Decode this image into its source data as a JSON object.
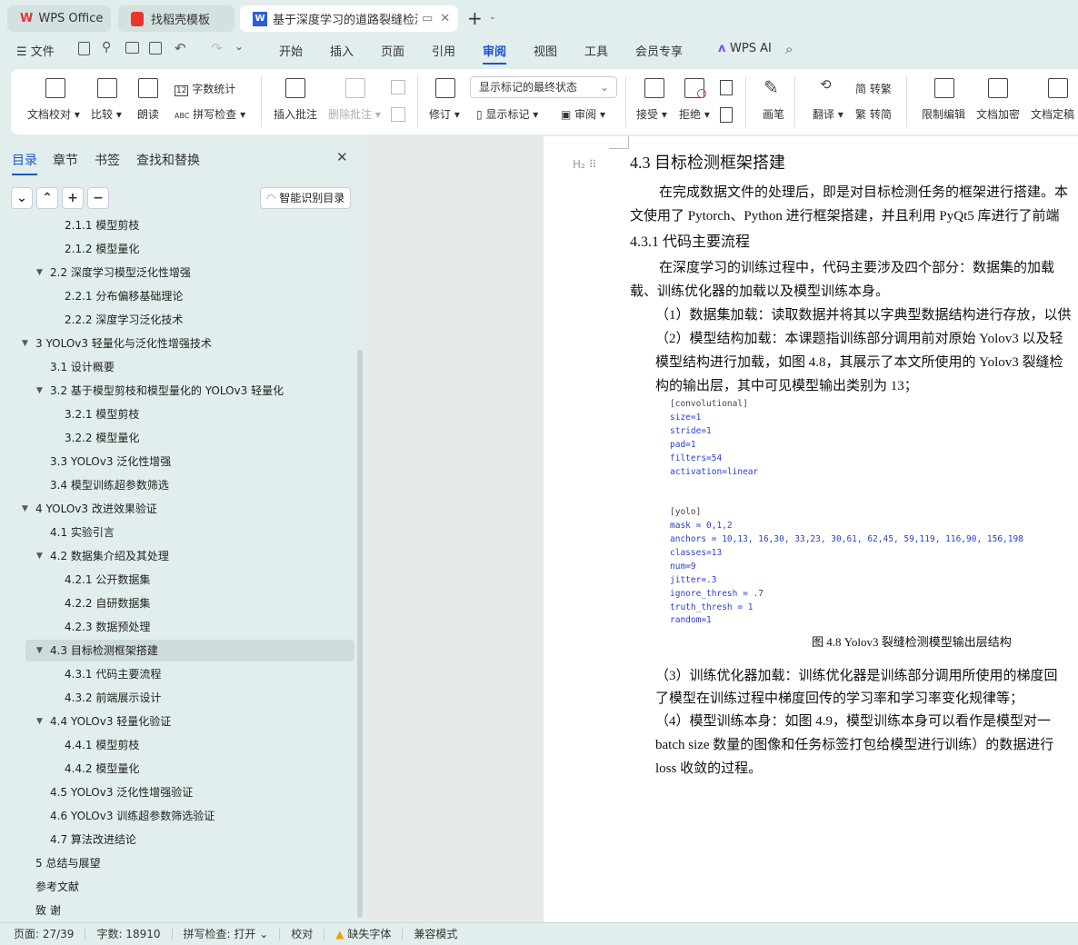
{
  "tabs": [
    {
      "label": "WPS Office",
      "icon": "wps-logo-icon"
    },
    {
      "label": "找稻壳模板",
      "icon": "docer-icon"
    },
    {
      "label": "基于深度学习的道路裂缝检测",
      "icon": "wps-writer-icon",
      "active": true
    }
  ],
  "menu": {
    "file": "文件",
    "items": [
      "开始",
      "插入",
      "页面",
      "引用",
      "审阅",
      "视图",
      "工具",
      "会员专享"
    ],
    "active": "审阅",
    "ai": "WPS AI"
  },
  "ribbon": {
    "proofread": "文档校对",
    "compare": "比较",
    "read_aloud": "朗读",
    "word_count": "字数统计",
    "spell_check": "拼写检查",
    "insert_comment": "插入批注",
    "delete_comment": "删除批注",
    "revise": "修订",
    "markup_state": "显示标记的最终状态",
    "show_markup": "显示标记",
    "review": "审阅",
    "accept": "接受",
    "reject": "拒绝",
    "pen": "画笔",
    "translate": "翻译",
    "to_traditional": "转繁",
    "to_simplified": "转简",
    "restrict_edit": "限制编辑",
    "encrypt": "文档加密",
    "finalize": "文档定稿"
  },
  "panel": {
    "tabs": [
      "目录",
      "章节",
      "书签",
      "查找和替换"
    ],
    "active": "目录",
    "smart_toc": "智能识别目录",
    "toc": [
      {
        "label": "2.1.1  模型剪枝",
        "level": 3
      },
      {
        "label": "2.1.2  模型量化",
        "level": 3
      },
      {
        "label": "2.2  深度学习模型泛化性增强",
        "level": 2,
        "expanded": true
      },
      {
        "label": "2.2.1  分布偏移基础理论",
        "level": 3
      },
      {
        "label": "2.2.2  深度学习泛化技术",
        "level": 3
      },
      {
        "label": "3  YOLOv3 轻量化与泛化性增强技术",
        "level": 1,
        "expanded": true
      },
      {
        "label": "3.1  设计概要",
        "level": 2
      },
      {
        "label": "3.2  基于模型剪枝和模型量化的 YOLOv3 轻量化",
        "level": 2,
        "expanded": true
      },
      {
        "label": "3.2.1  模型剪枝",
        "level": 3
      },
      {
        "label": "3.2.2  模型量化",
        "level": 3
      },
      {
        "label": "3.3  YOLOv3 泛化性增强",
        "level": 2
      },
      {
        "label": "3.4  模型训练超参数筛选",
        "level": 2
      },
      {
        "label": "4  YOLOv3 改进效果验证",
        "level": 1,
        "expanded": true
      },
      {
        "label": "4.1  实验引言",
        "level": 2
      },
      {
        "label": "4.2  数据集介绍及其处理",
        "level": 2,
        "expanded": true
      },
      {
        "label": "4.2.1  公开数据集",
        "level": 3
      },
      {
        "label": "4.2.2  自研数据集",
        "level": 3
      },
      {
        "label": "4.2.3  数据预处理",
        "level": 3
      },
      {
        "label": "4.3  目标检测框架搭建",
        "level": 2,
        "expanded": true,
        "selected": true
      },
      {
        "label": "4.3.1  代码主要流程",
        "level": 3
      },
      {
        "label": "4.3.2  前端展示设计",
        "level": 3
      },
      {
        "label": "4.4 YOLOv3 轻量化验证",
        "level": 2,
        "expanded": true
      },
      {
        "label": "4.4.1  模型剪枝",
        "level": 3
      },
      {
        "label": "4.4.2  模型量化",
        "level": 3
      },
      {
        "label": "4.5 YOLOv3 泛化性增强验证",
        "level": 2
      },
      {
        "label": "4.6 YOLOv3 训练超参数筛选验证",
        "level": 2
      },
      {
        "label": "4.7  算法改进结论",
        "level": 2
      },
      {
        "label": "5  总结与展望",
        "level": 1
      },
      {
        "label": "参考文献",
        "level": 1
      },
      {
        "label": "致  谢",
        "level": 1
      }
    ]
  },
  "doc": {
    "heading_marker": "H₂",
    "title": "4.3  目标检测框架搭建",
    "p1": [
      "在完成数据文件的处理后，即是对目标检测任务的框架进行搭建。本",
      "文使用了 Pytorch、Python 进行框架搭建，并且利用 PyQt5 库进行了前端"
    ],
    "h431": "4.3.1  代码主要流程",
    "p2": [
      "在深度学习的训练过程中，代码主要涉及四个部分：数据集的加载",
      "载、训练优化器的加载以及模型训练本身。"
    ],
    "p3": "（1）数据集加载：读取数据并将其以字典型数据结构进行存放，以供",
    "p4": [
      "（2）模型结构加载：本课题指训练部分调用前对原始 Yolov3 以及轻",
      "模型结构进行加载，如图 4.8，其展示了本文所使用的 Yolov3 裂缝检",
      "构的输出层，其中可见模型输出类别为 13；"
    ],
    "code": [
      "[convolutional]",
      "size=1",
      "stride=1",
      "pad=1",
      "filters=54",
      "activation=linear",
      "",
      "",
      "[yolo]",
      "mask = 0,1,2",
      "anchors = 10,13,  16,30,  33,23,  30,61,  62,45,  59,119,  116,90,  156,198",
      "classes=13",
      "num=9",
      "jitter=.3",
      "ignore_thresh = .7",
      "truth_thresh = 1",
      "random=1"
    ],
    "caption": "图 4.8 Yolov3 裂缝检测模型输出层结构",
    "p5": [
      "（3）训练优化器加载：训练优化器是训练部分调用所使用的梯度回",
      "了模型在训练过程中梯度回传的学习率和学习率变化规律等；"
    ],
    "p6": [
      "（4）模型训练本身：如图 4.9，模型训练本身可以看作是模型对一",
      "batch size 数量的图像和任务标签打包给模型进行训练）的数据进行",
      "loss 收敛的过程。"
    ]
  },
  "status": {
    "page": "页面: 27/39",
    "words": "字数: 18910",
    "spell": "拼写检查: 打开",
    "proof": "校对",
    "missing_font": "缺失字体",
    "compat": "兼容模式"
  },
  "colors": {
    "accent": "#1a56c8",
    "wps_red": "#e8362c",
    "warning": "#f0a500"
  }
}
